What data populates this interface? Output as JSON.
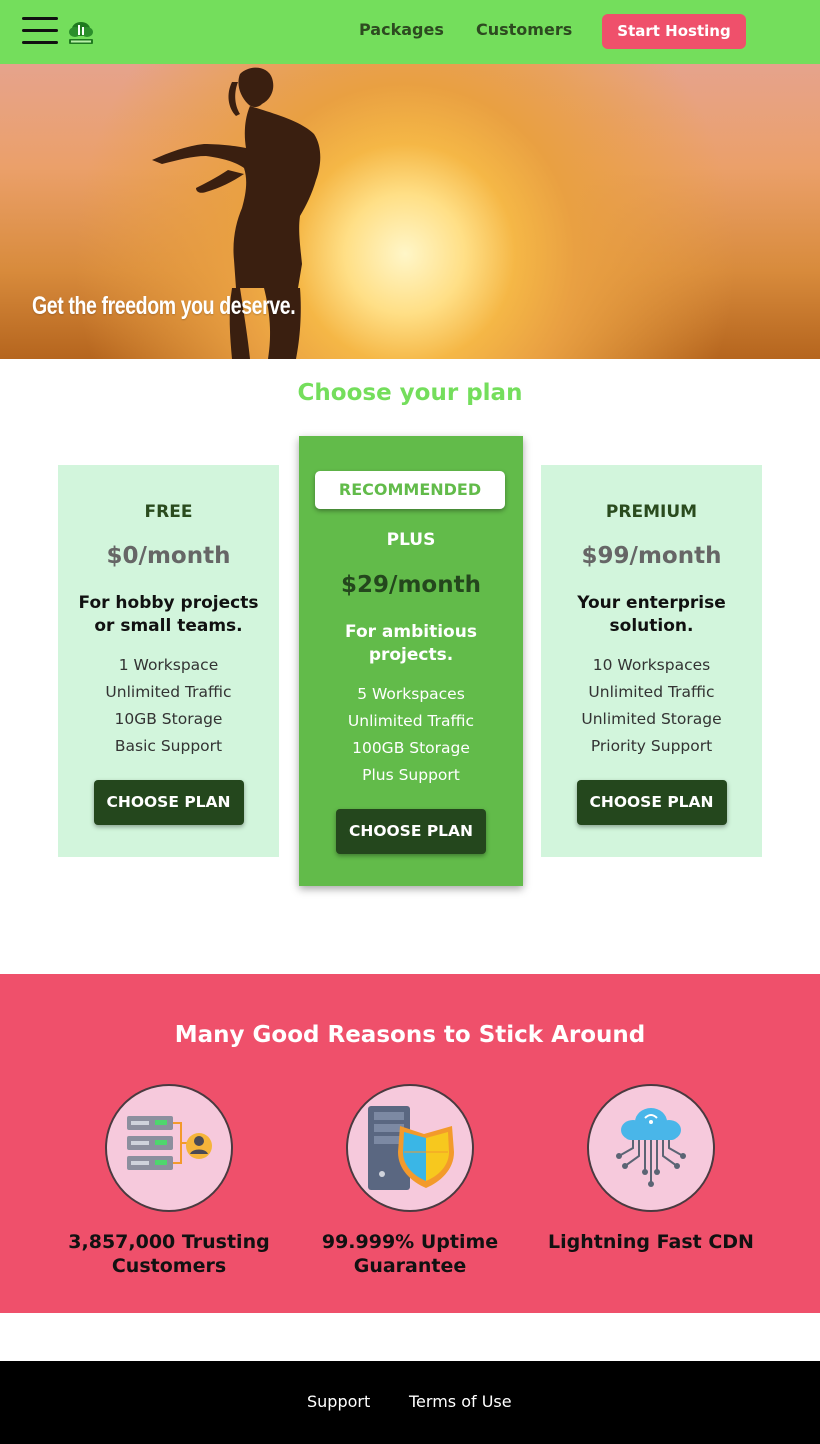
{
  "header": {
    "nav": [
      {
        "label": "Packages"
      },
      {
        "label": "Customers"
      }
    ],
    "cta_label": "Start Hosting",
    "menu_icon": "hamburger-menu-icon",
    "logo_icon": "cloud-logo-icon"
  },
  "hero": {
    "tagline": "Get the freedom you deserve."
  },
  "plans": {
    "title": "Choose your plan",
    "items": [
      {
        "name": "FREE",
        "price": "$0/month",
        "description": "For hobby projects or small teams.",
        "features": [
          "1 Workspace",
          "Unlimited Traffic",
          "10GB Storage",
          "Basic Support"
        ],
        "button": "CHOOSE PLAN"
      },
      {
        "badge": "RECOMMENDED",
        "name": "PLUS",
        "price": "$29/month",
        "description": "For ambitious projects.",
        "features": [
          "5 Workspaces",
          "Unlimited Traffic",
          "100GB Storage",
          "Plus Support"
        ],
        "button": "CHOOSE PLAN"
      },
      {
        "name": "PREMIUM",
        "price": "$99/month",
        "description": "Your enterprise solution.",
        "features": [
          "10 Workspaces",
          "Unlimited Traffic",
          "Unlimited Storage",
          "Priority Support"
        ],
        "button": "CHOOSE PLAN"
      }
    ]
  },
  "reasons": {
    "title": "Many Good Reasons to Stick Around",
    "items": [
      {
        "label": "3,857,000 Trusting Customers",
        "icon": "server-customers-icon"
      },
      {
        "label": "99.999% Uptime Guarantee",
        "icon": "server-shield-icon"
      },
      {
        "label": "Lightning Fast CDN",
        "icon": "cloud-network-icon"
      }
    ]
  },
  "footer": {
    "links": [
      {
        "label": "Support"
      },
      {
        "label": "Terms of Use"
      }
    ]
  },
  "colors": {
    "header_green": "#74de5c",
    "cta_red": "#ef506b",
    "plan_light": "#d2f5dc",
    "plan_recommended": "#62bb4a",
    "button_dark": "#24471d",
    "footer_black": "#000000"
  }
}
